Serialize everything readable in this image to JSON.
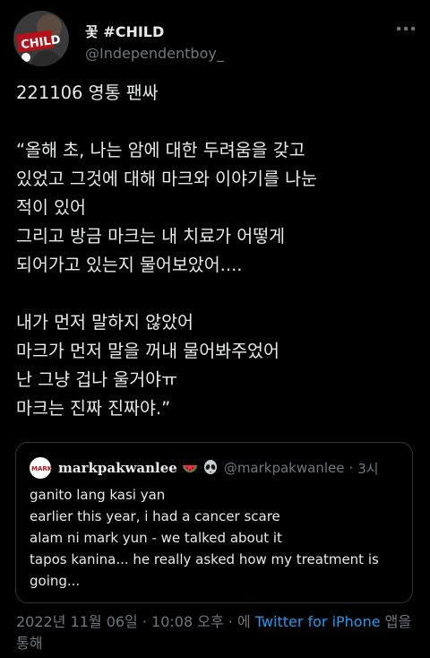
{
  "author": {
    "display_name": "꽃 #CHILD",
    "handle": "@Independentboy_",
    "avatar_text": "CHILD"
  },
  "tweet": {
    "lines": [
      "221106 영통 팬싸",
      "",
      "“올해 초, 나는 암에 대한 두려움을 갖고",
      "있었고 그것에 대해 마크와 이야기를 나눈",
      "적이 있어",
      "그리고 방금 마크는 내 치료가 어떻게",
      "되어가고 있는지 물어보았어....",
      "",
      "내가 먼저 말하지 않았어",
      "마크가 먼저 말을 꺼내 물어봐주었어",
      "난 그냥 겁나 울거야ㅠ",
      "마크는 진짜 진짜야.”"
    ]
  },
  "quote": {
    "name": "markpakwanlee",
    "emojis": [
      "watermelon-emoji",
      "alien-emoji"
    ],
    "handle": "@markpakwanlee",
    "separator": "·",
    "time": "3시",
    "avatar_text": "MARK",
    "lines": [
      "ganito lang kasi yan",
      "earlier this year, i had a cancer scare",
      "alam ni mark yun - we talked about it",
      "tapos kanina... he really asked how my treatment is",
      "going..."
    ]
  },
  "meta": {
    "date": "2022년 11월 06일",
    "dot1": " · ",
    "time": "10:08 오후",
    "dot2": " · ",
    "via_prefix": "에 ",
    "source": "Twitter for iPhone",
    "via_suffix_1": " 앱을",
    "via_suffix_2": "통해"
  },
  "colors": {
    "background": "#000000",
    "text": "#e7e9ea",
    "secondary": "#71767b",
    "link": "#1d9bf0",
    "border": "#2f3336"
  }
}
